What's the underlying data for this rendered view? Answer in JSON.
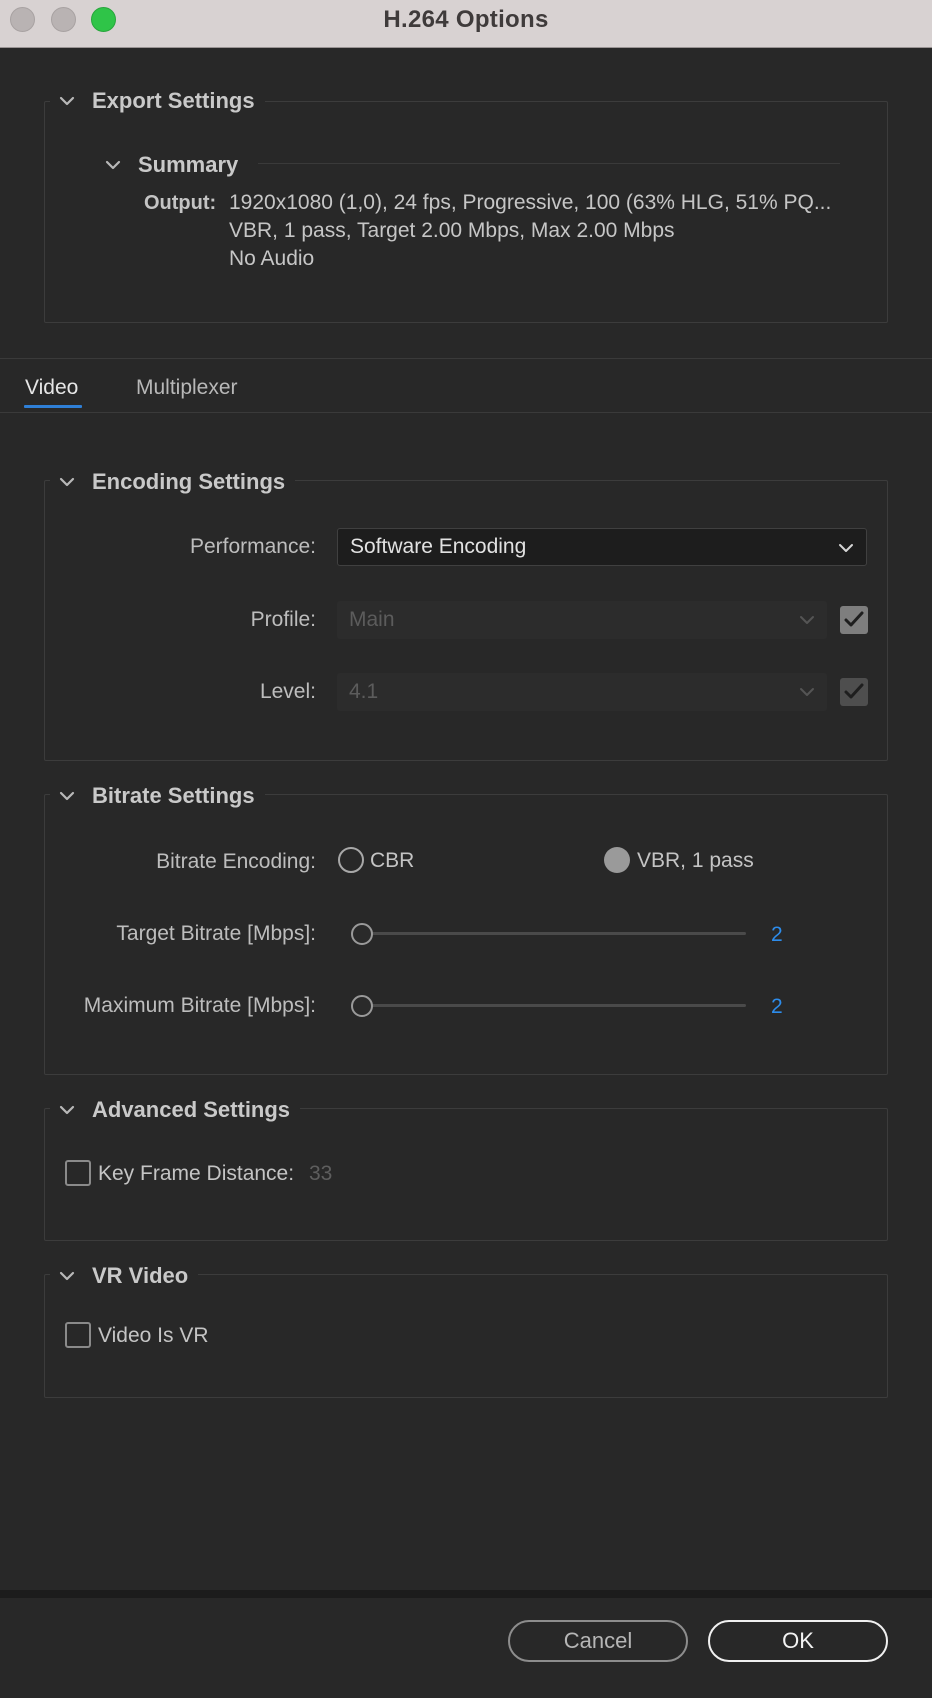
{
  "window": {
    "title": "H.264 Options"
  },
  "export_settings": {
    "title": "Export Settings",
    "summary": {
      "title": "Summary",
      "output_label": "Output:",
      "lines": [
        "1920x1080 (1,0), 24 fps, Progressive, 100 (63% HLG, 51% PQ...",
        "VBR, 1 pass, Target 2.00 Mbps, Max 2.00 Mbps",
        "No Audio"
      ]
    }
  },
  "tabs": [
    {
      "label": "Video",
      "active": true
    },
    {
      "label": "Multiplexer",
      "active": false
    }
  ],
  "encoding": {
    "title": "Encoding Settings",
    "performance_label": "Performance:",
    "performance_value": "Software Encoding",
    "profile_label": "Profile:",
    "profile_value": "Main",
    "profile_checked": true,
    "level_label": "Level:",
    "level_value": "4.1",
    "level_checked": true
  },
  "bitrate": {
    "title": "Bitrate Settings",
    "encoding_label": "Bitrate Encoding:",
    "options": [
      {
        "label": "CBR",
        "selected": false
      },
      {
        "label": "VBR, 1 pass",
        "selected": true
      }
    ],
    "target_label": "Target Bitrate [Mbps]:",
    "target_value": "2",
    "max_label": "Maximum Bitrate [Mbps]:",
    "max_value": "2"
  },
  "advanced": {
    "title": "Advanced Settings",
    "keyframe_label": "Key Frame Distance:",
    "keyframe_value": "33",
    "keyframe_checked": false
  },
  "vr": {
    "title": "VR Video",
    "vr_label": "Video Is VR",
    "vr_checked": false
  },
  "buttons": {
    "cancel": "Cancel",
    "ok": "OK"
  },
  "colors": {
    "accent": "#2f7fd6",
    "slider_value": "#2d8ceb",
    "background": "#282828"
  }
}
